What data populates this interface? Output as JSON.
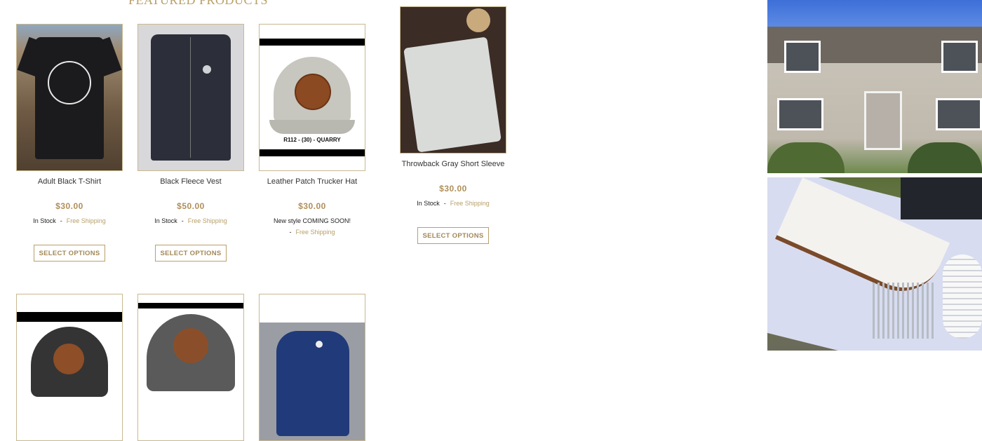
{
  "section": {
    "title": "FEATURED PRODUCTS"
  },
  "products": [
    {
      "name": "Adult Black T-Shirt",
      "price": "$30.00",
      "stock": "In Stock",
      "separator": "-",
      "shipping": "Free Shipping",
      "button": "SELECT OPTIONS"
    },
    {
      "name": "Black Fleece Vest",
      "price": "$50.00",
      "stock": "In Stock",
      "separator": "-",
      "shipping": "Free Shipping",
      "button": "SELECT OPTIONS"
    },
    {
      "name": "Leather Patch Trucker Hat",
      "price": "$30.00",
      "note": "New style COMING SOON!",
      "separator": "-",
      "shipping": "Free Shipping",
      "hat_label": "R112 - (30) - QUARRY"
    },
    {
      "name": "Throwback Gray Short Sleeve",
      "price": "$30.00",
      "stock": "In Stock",
      "separator": "-",
      "shipping": "Free Shipping",
      "button": "SELECT OPTIONS"
    }
  ]
}
